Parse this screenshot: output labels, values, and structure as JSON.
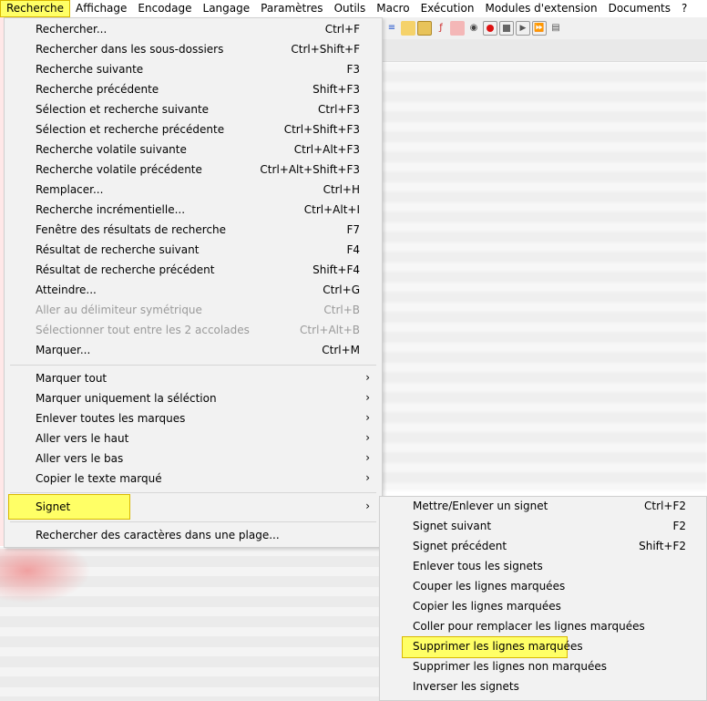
{
  "menubar": [
    "Recherche",
    "Affichage",
    "Encodage",
    "Langage",
    "Paramètres",
    "Outils",
    "Macro",
    "Exécution",
    "Modules d'extension",
    "Documents",
    "?"
  ],
  "search_menu": {
    "items": [
      {
        "label": "Rechercher...",
        "shortcut": "Ctrl+F"
      },
      {
        "label": "Rechercher dans les sous-dossiers",
        "shortcut": "Ctrl+Shift+F"
      },
      {
        "label": "Recherche suivante",
        "shortcut": "F3"
      },
      {
        "label": "Recherche précédente",
        "shortcut": "Shift+F3"
      },
      {
        "label": "Sélection et recherche suivante",
        "shortcut": "Ctrl+F3"
      },
      {
        "label": "Sélection et recherche précédente",
        "shortcut": "Ctrl+Shift+F3"
      },
      {
        "label": "Recherche volatile suivante",
        "shortcut": "Ctrl+Alt+F3"
      },
      {
        "label": "Recherche volatile précédente",
        "shortcut": "Ctrl+Alt+Shift+F3"
      },
      {
        "label": "Remplacer...",
        "shortcut": "Ctrl+H"
      },
      {
        "label": "Recherche incrémentielle...",
        "shortcut": "Ctrl+Alt+I"
      },
      {
        "label": "Fenêtre des résultats de recherche",
        "shortcut": "F7"
      },
      {
        "label": "Résultat de recherche suivant",
        "shortcut": "F4"
      },
      {
        "label": "Résultat de recherche précédent",
        "shortcut": "Shift+F4"
      },
      {
        "label": "Atteindre...",
        "shortcut": "Ctrl+G"
      },
      {
        "label": "Aller au délimiteur symétrique",
        "shortcut": "Ctrl+B"
      },
      {
        "label": "Sélectionner tout entre les 2 accolades",
        "shortcut": "Ctrl+Alt+B"
      },
      {
        "label": "Marquer...",
        "shortcut": "Ctrl+M"
      }
    ],
    "submenus": [
      "Marquer tout",
      "Marquer uniquement la séléction",
      "Enlever toutes les marques",
      "Aller vers le haut",
      "Aller vers le bas",
      "Copier le texte marqué"
    ],
    "signet": "Signet",
    "last": "Rechercher des caractères dans une plage..."
  },
  "bookmark_menu": {
    "items": [
      {
        "label": "Mettre/Enlever un signet",
        "shortcut": "Ctrl+F2"
      },
      {
        "label": "Signet suivant",
        "shortcut": "F2"
      },
      {
        "label": "Signet précédent",
        "shortcut": "Shift+F2"
      },
      {
        "label": "Enlever tous les signets",
        "shortcut": ""
      },
      {
        "label": "Couper les lignes marquées",
        "shortcut": ""
      },
      {
        "label": "Copier les lignes marquées",
        "shortcut": ""
      },
      {
        "label": "Coller pour remplacer les lignes marquées",
        "shortcut": ""
      },
      {
        "label": "Supprimer les lignes marquées",
        "shortcut": ""
      },
      {
        "label": "Supprimer les lignes non marquées",
        "shortcut": ""
      },
      {
        "label": "Inverser les signets",
        "shortcut": ""
      }
    ]
  },
  "colors": {
    "highlight": "#ffff66",
    "menu_bg": "#f2f2f2",
    "disabled": "#9a9a9a"
  },
  "toolbar_icons": [
    "align-icon",
    "folder-icon",
    "map-icon",
    "pdf-icon",
    "folder-pink-icon",
    "eye-icon",
    "record-icon",
    "stop-icon",
    "play-icon",
    "run-multiple-icon",
    "save-macro-icon"
  ]
}
